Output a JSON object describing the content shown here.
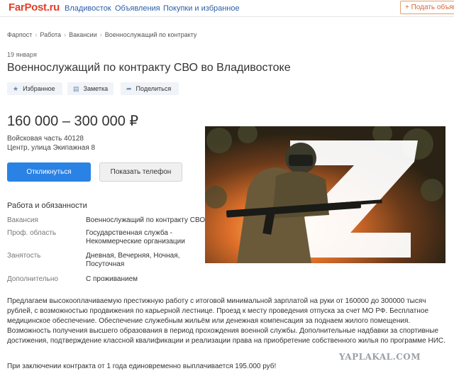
{
  "header": {
    "logo_main": "FarPost",
    "logo_tld": ".ru",
    "nav": [
      "Владивосток",
      "Объявления",
      "Покупки и избранное"
    ],
    "post_button": "+ Подать объяв"
  },
  "breadcrumbs": [
    "Фарпост",
    "Работа",
    "Вакансии",
    "Военнослужащий по контракту"
  ],
  "date": "19 января",
  "title": "Военнослужащий по контракту СВО во Владивостоке",
  "actions": [
    "Избранное",
    "Заметка",
    "Поделиться"
  ],
  "price": "160 000 – 300 000 ₽",
  "address": [
    "Войсковая часть 40128",
    "Центр, улица Экипажная 8"
  ],
  "buttons": {
    "respond": "Откликнуться",
    "show_phone": "Показать телефон"
  },
  "section_title": "Работа и обязанности",
  "details": [
    {
      "label": "Вакансия",
      "value": "Военнослужащий по контракту СВО"
    },
    {
      "label": "Проф. область",
      "value": "Государственная служба - Некоммерческие организации"
    },
    {
      "label": "Занятость",
      "value": "Дневная, Вечерняя, Ночная, Посуточная"
    },
    {
      "label": "Дополнительно",
      "value": "С проживанием"
    }
  ],
  "description": "Предлагаем высокооплачиваемую престижную работу с итоговой минимальной зарплатой на руки от 160000 до 300000 тысяч рублей, с возможностью продвижения по карьерной лестнице. Проезд к месту проведения отпуска за счет МО РФ. Бесплатное медицинское обеспечение. Обеспечение служебным жильём или денежная компенсация за поднаем жилого помещения. Возможность получения высшего образования в период прохождения военной службы. Дополнительные надбавки за спортивные достижения, подтверждение классной квалификации и реализации права на приобретение собственного жилья по программе НИС.",
  "bonus": "При заключении контракта от 1 года единовременно выплачивается 195.000 руб!",
  "watermark": "YAPLAKAL.COM",
  "colors": {
    "brand": "#e0402a",
    "link": "#2b5ea8",
    "primary": "#2a82e4"
  }
}
